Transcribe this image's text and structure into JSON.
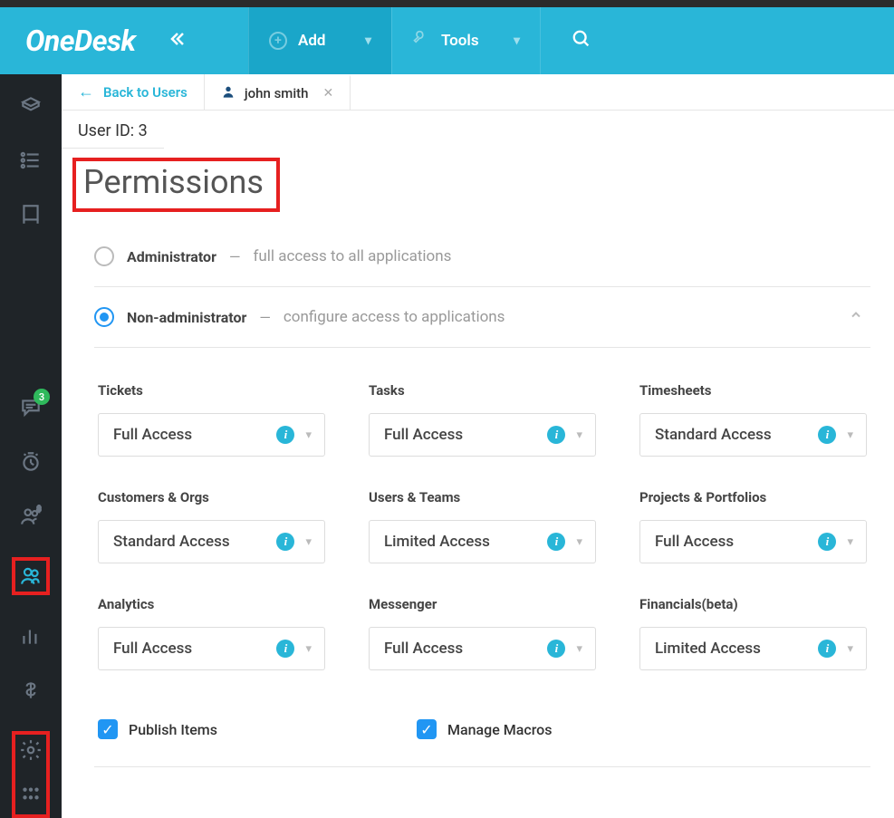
{
  "header": {
    "logo": "OneDesk",
    "add_label": "Add",
    "tools_label": "Tools"
  },
  "sidebar": {
    "chat_badge": "3"
  },
  "tabs": {
    "back_label": "Back to Users",
    "user_name": "john smith"
  },
  "user_id_label": "User ID: 3",
  "permissions_title": "Permissions",
  "roles": {
    "admin": {
      "label": "Administrator",
      "desc": "full access to all applications"
    },
    "nonadmin": {
      "label": "Non-administrator",
      "desc": "configure access to applications"
    }
  },
  "perms": [
    {
      "label": "Tickets",
      "value": "Full Access"
    },
    {
      "label": "Tasks",
      "value": "Full Access"
    },
    {
      "label": "Timesheets",
      "value": "Standard Access"
    },
    {
      "label": "Customers & Orgs",
      "value": "Standard Access"
    },
    {
      "label": "Users & Teams",
      "value": "Limited Access"
    },
    {
      "label": "Projects & Portfolios",
      "value": "Full Access"
    },
    {
      "label": "Analytics",
      "value": "Full Access"
    },
    {
      "label": "Messenger",
      "value": "Full Access"
    },
    {
      "label": "Financials(beta)",
      "value": "Limited Access"
    }
  ],
  "checks": {
    "publish": "Publish Items",
    "macros": "Manage Macros"
  }
}
